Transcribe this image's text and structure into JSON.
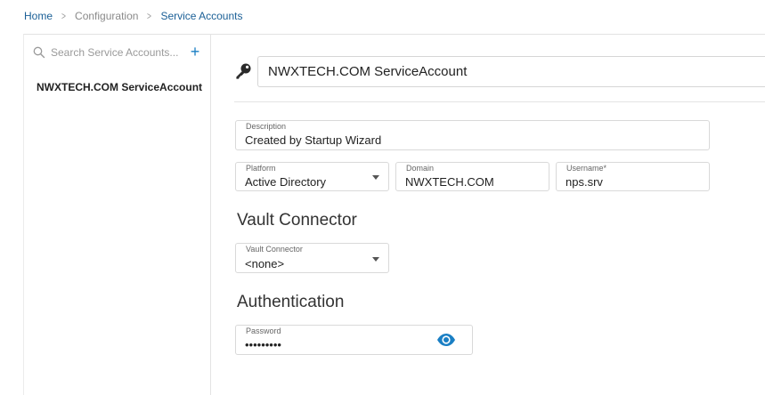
{
  "breadcrumb": {
    "home": "Home",
    "configuration": "Configuration",
    "current": "Service Accounts",
    "separator": ">"
  },
  "sidebar": {
    "search_placeholder": "Search Service Accounts...",
    "add_label": "+",
    "items": [
      {
        "label": "NWXTECH.COM ServiceAccount"
      }
    ]
  },
  "form": {
    "name": "NWXTECH.COM ServiceAccount",
    "description": {
      "label": "Description",
      "value": "Created by Startup Wizard"
    },
    "platform": {
      "label": "Platform",
      "value": "Active Directory"
    },
    "domain": {
      "label": "Domain",
      "value": "NWXTECH.COM"
    },
    "username": {
      "label": "Username*",
      "value": "nps.srv"
    },
    "vault_heading": "Vault Connector",
    "vault_connector": {
      "label": "Vault Connector",
      "value": "<none>"
    },
    "auth_heading": "Authentication",
    "password": {
      "label": "Password",
      "value": "•••••••••"
    }
  },
  "colors": {
    "accent": "#1a7fc4",
    "link": "#1a5f96"
  },
  "icons": {
    "search": "search-icon",
    "add": "plus-icon",
    "key": "key-icon",
    "dropdown": "chevron-down-icon",
    "reveal": "eye-icon"
  }
}
